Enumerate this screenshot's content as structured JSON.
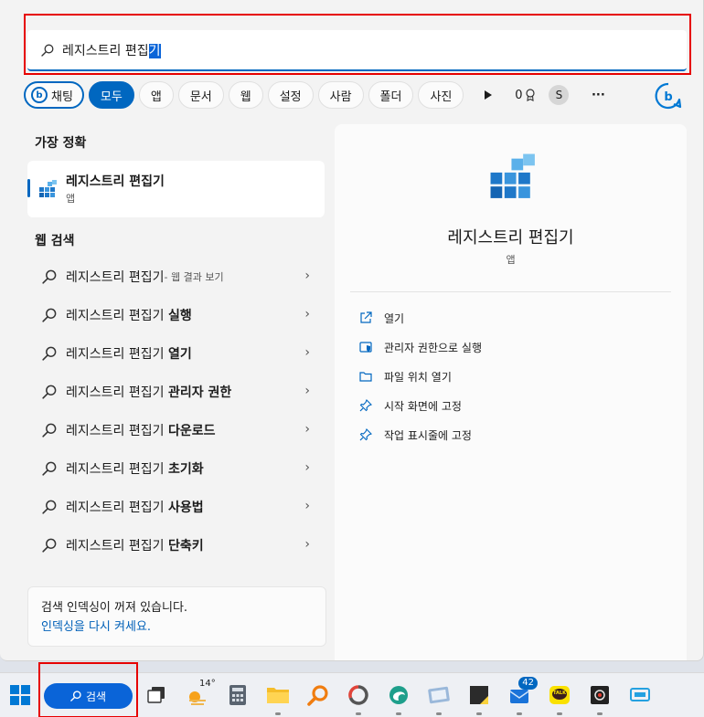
{
  "search": {
    "query_prefix": "레지스트리 편집",
    "query_selected": "기"
  },
  "filters": {
    "chat": "채팅",
    "items": [
      "모두",
      "앱",
      "문서",
      "웹",
      "설정",
      "사람",
      "폴더",
      "사진"
    ],
    "points": "0",
    "avatar": "S",
    "more": "···"
  },
  "best_match": {
    "title": "가장 정확",
    "name": "레지스트리 편집기",
    "type": "앱"
  },
  "web_search": {
    "title": "웹 검색",
    "first": {
      "base": "레지스트리 편집기",
      "sub": " - 웹 결과 보기"
    },
    "items": [
      {
        "base": "레지스트리 편집기 ",
        "bold": "실행"
      },
      {
        "base": "레지스트리 편집기 ",
        "bold": "열기"
      },
      {
        "base": "레지스트리 편집기 ",
        "bold": "관리자 권한"
      },
      {
        "base": "레지스트리 편집기 ",
        "bold": "다운로드"
      },
      {
        "base": "레지스트리 편집기 ",
        "bold": "초기화"
      },
      {
        "base": "레지스트리 편집기 ",
        "bold": "사용법"
      },
      {
        "base": "레지스트리 편집기 ",
        "bold": "단축키"
      }
    ]
  },
  "indexing": {
    "line1": "검색 인덱싱이 꺼져 있습니다.",
    "link": "인덱싱을 다시 켜세요."
  },
  "details": {
    "name": "레지스트리 편집기",
    "type": "앱",
    "actions": [
      "열기",
      "관리자 권한으로 실행",
      "파일 위치 열기",
      "시작 화면에 고정",
      "작업 표시줄에 고정"
    ]
  },
  "taskbar": {
    "search_label": "검색",
    "weather_temp": "14°",
    "mail_badge": "42",
    "kakao_label": "TALK"
  },
  "colors": {
    "accent": "#0067c0",
    "highlight_box": "#e60000"
  }
}
